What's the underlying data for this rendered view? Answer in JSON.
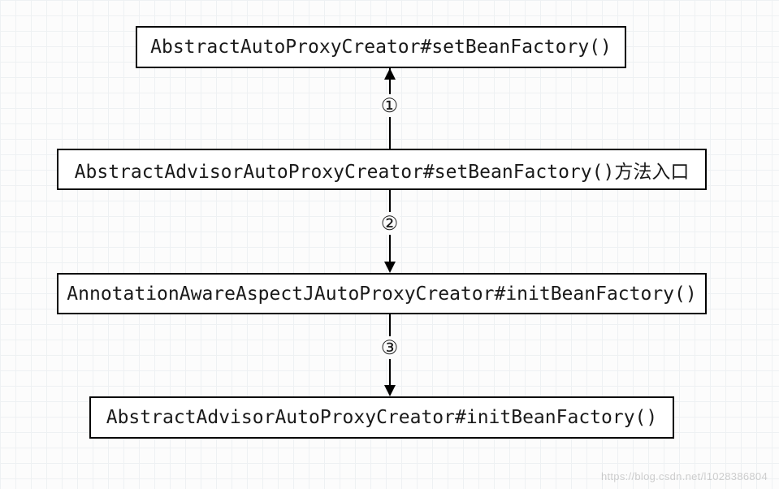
{
  "diagram": {
    "nodes": {
      "n1": "AbstractAutoProxyCreator#setBeanFactory()",
      "n2": "AbstractAdvisorAutoProxyCreator#setBeanFactory()方法入口",
      "n3": "AnnotationAwareAspectJAutoProxyCreator#initBeanFactory()",
      "n4": "AbstractAdvisorAutoProxyCreator#initBeanFactory()"
    },
    "steps": {
      "s1": "①",
      "s2": "②",
      "s3": "③"
    },
    "edges": [
      {
        "from": "n2",
        "to": "n1",
        "label": "①",
        "direction": "up"
      },
      {
        "from": "n2",
        "to": "n3",
        "label": "②",
        "direction": "down"
      },
      {
        "from": "n3",
        "to": "n4",
        "label": "③",
        "direction": "down"
      }
    ]
  },
  "watermark": "https://blog.csdn.net/l1028386804"
}
